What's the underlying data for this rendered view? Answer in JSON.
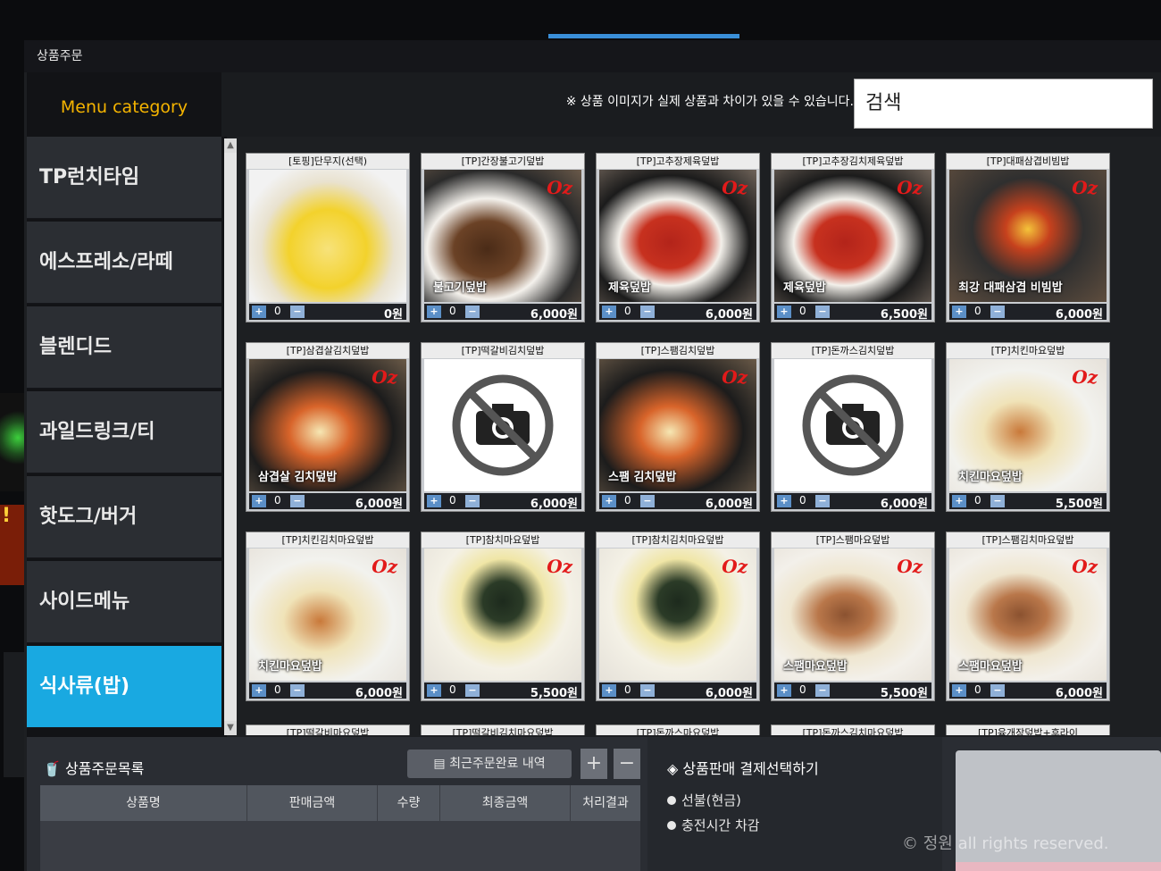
{
  "window": {
    "title": "상품주문"
  },
  "category_header": "Menu category",
  "notice": "※ 상품 이미지가 실제 상품과 차이가 있을 수 있습니다.",
  "search": {
    "value": "검색"
  },
  "categories": [
    {
      "label": "TP런치타임"
    },
    {
      "label": "에스프레소/라떼"
    },
    {
      "label": "블렌디드"
    },
    {
      "label": "과일드링크/티"
    },
    {
      "label": "핫도그/버거"
    },
    {
      "label": "사이드메뉴"
    },
    {
      "label": "식사류(밥)",
      "active": true
    }
  ],
  "logo_text": "Oz",
  "products": [
    {
      "name": "[토핑]단무지(선택)",
      "qty": "0",
      "price": "0원",
      "style": "danmuji",
      "overlay": ""
    },
    {
      "name": "[TP]간장불고기덮밥",
      "qty": "0",
      "price": "6,000원",
      "style": "bulgogi",
      "overlay": "불고기덮밥"
    },
    {
      "name": "[TP]고추장제육덮밥",
      "qty": "0",
      "price": "6,000원",
      "style": "jeyuk",
      "overlay": "제육덮밥"
    },
    {
      "name": "[TP]고추장김치제육덮밥",
      "qty": "0",
      "price": "6,500원",
      "style": "jeyuk",
      "overlay": "제육덮밥"
    },
    {
      "name": "[TP]대패삼겹비빔밥",
      "qty": "0",
      "price": "6,000원",
      "style": "bibim",
      "overlay": "최강 대패삼겹 비빔밥"
    },
    {
      "name": "[TP]삼겹살김치덮밥",
      "qty": "0",
      "price": "6,000원",
      "style": "kimchi",
      "overlay": "삼겹살 김치덮밥"
    },
    {
      "name": "[TP]떡갈비김치덮밥",
      "qty": "0",
      "price": "6,000원",
      "style": "none",
      "overlay": ""
    },
    {
      "name": "[TP]스팸김치덮밥",
      "qty": "0",
      "price": "6,000원",
      "style": "kimchi",
      "overlay": "스팸 김치덮밥"
    },
    {
      "name": "[TP]돈까스김치덮밥",
      "qty": "0",
      "price": "6,000원",
      "style": "none",
      "overlay": ""
    },
    {
      "name": "[TP]치킨마요덮밥",
      "qty": "0",
      "price": "5,500원",
      "style": "mayo",
      "overlay": "치킨마요덮밥"
    },
    {
      "name": "[TP]치킨김치마요덮밥",
      "qty": "0",
      "price": "6,000원",
      "style": "mayo",
      "overlay": "치킨마요덮밥"
    },
    {
      "name": "[TP]참치마요덮밥",
      "qty": "0",
      "price": "5,500원",
      "style": "tuna",
      "overlay": ""
    },
    {
      "name": "[TP]참치김치마요덮밥",
      "qty": "0",
      "price": "6,000원",
      "style": "tuna",
      "overlay": ""
    },
    {
      "name": "[TP]스팸마요덮밥",
      "qty": "0",
      "price": "5,500원",
      "style": "spam",
      "overlay": "스팸마요덮밥"
    },
    {
      "name": "[TP]스팸김치마요덮밥",
      "qty": "0",
      "price": "6,000원",
      "style": "spam",
      "overlay": "스팸마요덮밥"
    }
  ],
  "partial_row": [
    "[TP]떡갈비마요덮밥",
    "[TP]떡갈비김치마요덮밥",
    "[TP]돈까스마요덮밥",
    "[TP]돈까스김치마요덮밥",
    "[TP]육개장덮밥+후라이"
  ],
  "order_list": {
    "title": "상품주문목록",
    "recent_button": "최근주문완료 내역",
    "add": "+",
    "remove": "−",
    "columns": [
      "상품명",
      "판매금액",
      "수량",
      "최종금액",
      "처리결과"
    ]
  },
  "payment": {
    "title": "상품판매 결제선택하기",
    "options": [
      "선불(현금)",
      "충전시간 차감"
    ]
  },
  "watermark": "© 정원 all rights reserved.",
  "colors": {
    "accent": "#19a9e1",
    "header_text": "#f5b400",
    "logo": "#e21a1a"
  }
}
